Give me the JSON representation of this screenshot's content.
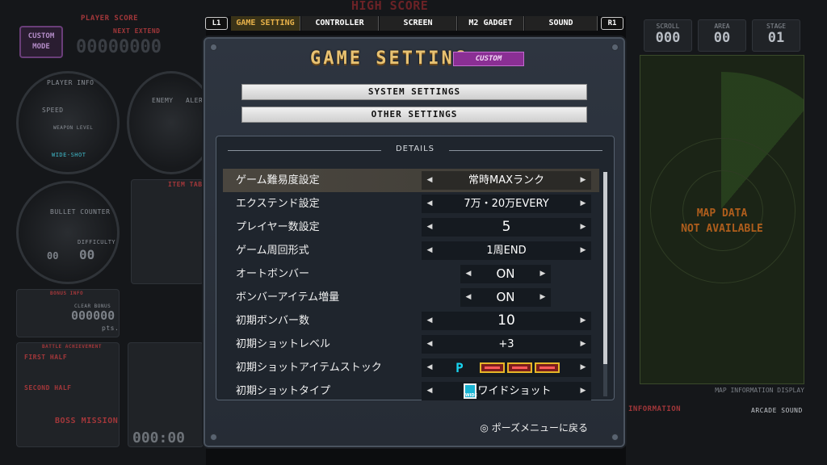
{
  "background": {
    "custom_mode": "CUSTOM MODE",
    "player_score_label": "PLAYER SCORE",
    "next_extend": "NEXT EXTEND",
    "score_digits": "00000000",
    "player_info": "PLAYER INFO",
    "speed_label": "SPEED",
    "weapon_level": "WEAPON LEVEL",
    "wide_shot": "WIDE-SHOT",
    "bullet_counter": "BULLET COUNTER",
    "difficulty": "DIFFICULTY",
    "difficulty_value": "00",
    "speed_value": "00",
    "bonus_info": "BONUS INFO",
    "clear_bonus": "CLEAR BONUS",
    "clear_bonus_value": "000000",
    "pts": "pts.",
    "battle_achievement": "BATTLE ACHIEVEMENT",
    "first_half": "FIRST HALF",
    "second_half": "SECOND HALF",
    "boss_mission": "BOSS MISSION",
    "item_table": "ITEM TABLE",
    "enemy": "ENEMY",
    "alert": "ALER",
    "playtime_value": "000:00",
    "high_score_label": "HIGH SCORE",
    "stats": [
      {
        "label": "SCROLL",
        "value": "000"
      },
      {
        "label": "AREA",
        "value": "00"
      },
      {
        "label": "STAGE",
        "value": "01"
      }
    ],
    "map_na_1": "MAP DATA",
    "map_na_2": "NOT AVAILABLE",
    "map_info_display": "MAP INFORMATION DISPLAY",
    "information": "INFORMATION",
    "arcade_sound": "ARCADE SOUND"
  },
  "tabs": {
    "left_hint": "L1",
    "right_hint": "R1",
    "items": [
      "GAME SETTING",
      "CONTROLLER",
      "SCREEN",
      "M2 GADGET",
      "SOUND"
    ]
  },
  "dialog": {
    "title": "GAME SETTING",
    "badge": "CUSTOM",
    "system_settings": "SYSTEM SETTINGS",
    "other_settings": "OTHER SETTINGS",
    "details_title": "DETAILS",
    "footer_hint": "◎ ポーズメニューに戻る"
  },
  "settings": [
    {
      "label": "ゲーム難易度設定",
      "value": "常時MAXランク"
    },
    {
      "label": "エクステンド設定",
      "value": "7万・20万EVERY"
    },
    {
      "label": "プレイヤー数設定",
      "value": "5"
    },
    {
      "label": "ゲーム周回形式",
      "value": "1周END"
    },
    {
      "label": "オートボンバー",
      "value": "ON"
    },
    {
      "label": "ボンバーアイテム増量",
      "value": "ON"
    },
    {
      "label": "初期ボンバー数",
      "value": "10"
    },
    {
      "label": "初期ショットレベル",
      "value": "+3"
    },
    {
      "label": "初期ショットアイテムストック",
      "value": "P"
    },
    {
      "label": "初期ショットタイプ",
      "value": "ワイドショット",
      "icon_text": "WIDE"
    }
  ],
  "colors": {
    "title_gold": "#e8c272",
    "badge_purple": "#8a2f94",
    "tab_active": "#e8b24a",
    "map_na_orange": "#c8681e"
  }
}
